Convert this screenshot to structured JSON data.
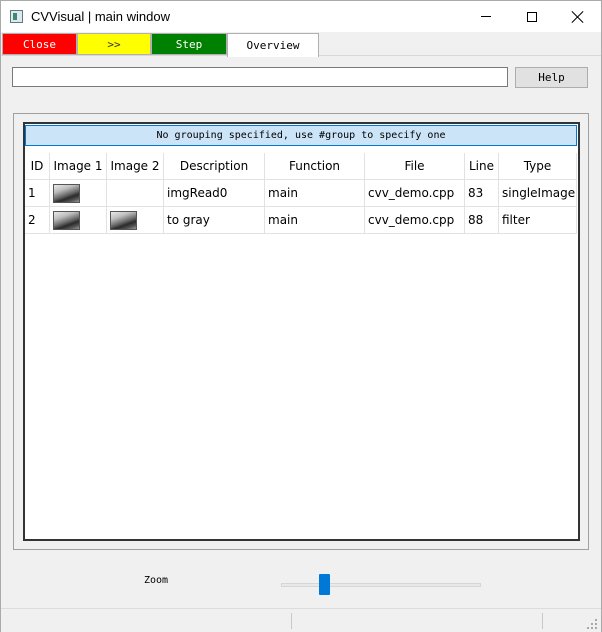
{
  "window": {
    "title": "CVVisual | main window"
  },
  "tabs": [
    {
      "label": "Close",
      "color": "#ff0000"
    },
    {
      "label": ">>",
      "color": "#ffff00"
    },
    {
      "label": "Step",
      "color": "#008000"
    },
    {
      "label": "Overview",
      "color": "#ffffff"
    }
  ],
  "filter": {
    "value": "",
    "help_label": "Help"
  },
  "group": {
    "header": "No grouping specified, use #group to specify one",
    "header_color": "#cce4f7"
  },
  "table": {
    "columns": [
      "ID",
      "Image 1",
      "Image 2",
      "Description",
      "Function",
      "File",
      "Line",
      "Type"
    ],
    "rows": [
      {
        "id": "1",
        "image1": "thumbnail",
        "image2": "",
        "description": "imgRead0",
        "function": "main",
        "file": "cvv_demo.cpp",
        "line": "83",
        "type": "singleImage"
      },
      {
        "id": "2",
        "image1": "thumbnail",
        "image2": "thumbnail",
        "description": "to gray",
        "function": "main",
        "file": "cvv_demo.cpp",
        "line": "88",
        "type": "filter"
      }
    ]
  },
  "zoom": {
    "label": "Zoom",
    "value_fraction": 0.21,
    "accent": "#0078d7"
  }
}
